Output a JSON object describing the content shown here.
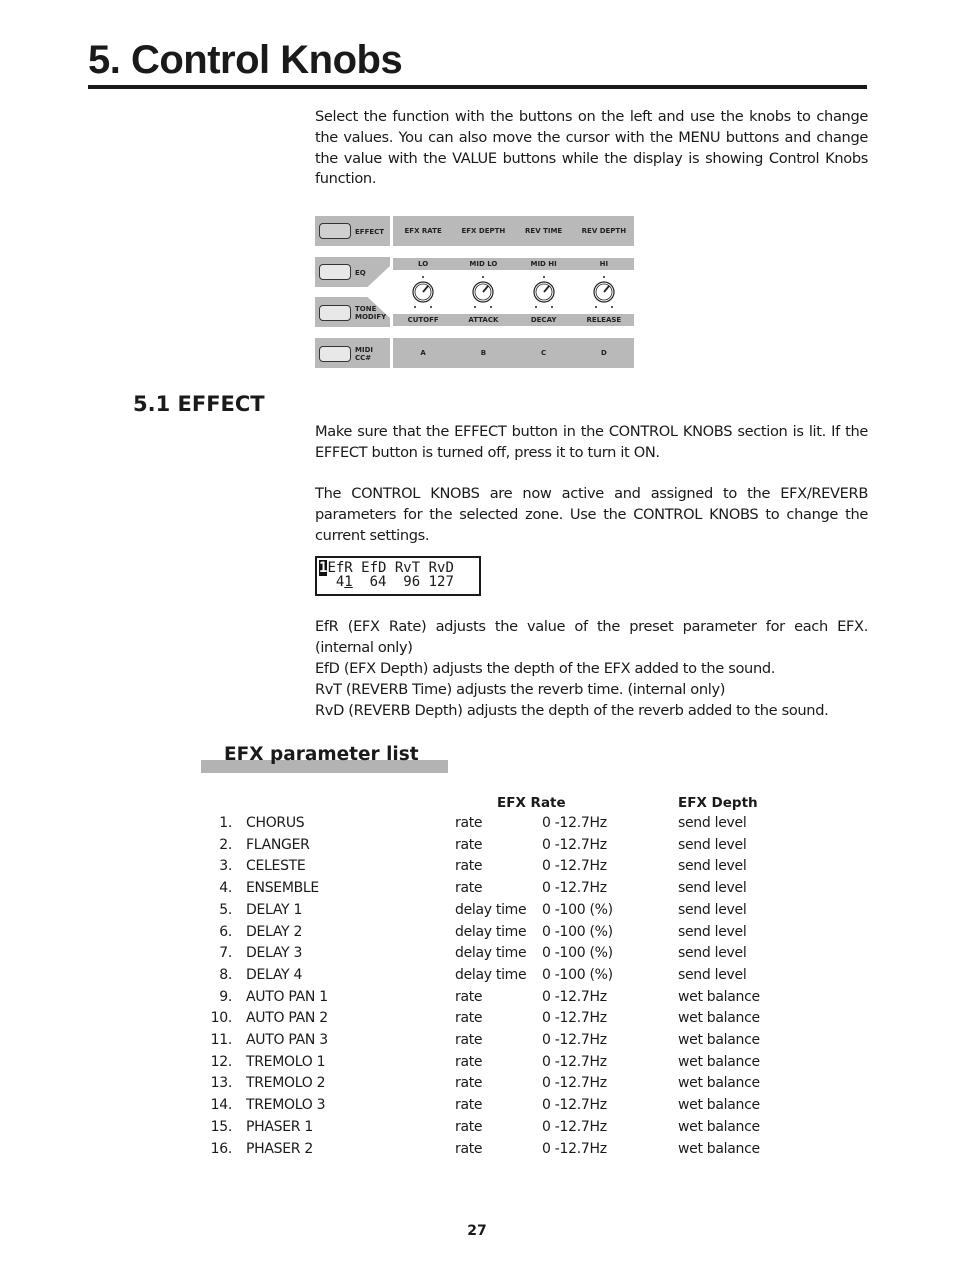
{
  "page": {
    "title": "5. Control Knobs",
    "intro": "Select the function with the buttons on the left and use the knobs to change the values.  You can also move the cursor with the MENU buttons and change the value with the VALUE buttons while the display is showing Control Knobs function.",
    "page_number": "27"
  },
  "panel": {
    "buttons": [
      {
        "label_line1": "EFFECT",
        "label_line2": ""
      },
      {
        "label_line1": "EQ",
        "label_line2": ""
      },
      {
        "label_line1": "TONE",
        "label_line2": "MODIFY"
      },
      {
        "label_line1": "MIDI",
        "label_line2": "CC#"
      }
    ],
    "effect_row": [
      "EFX RATE",
      "EFX DEPTH",
      "REV TIME",
      "REV DEPTH"
    ],
    "eq_row": [
      "LO",
      "MID LO",
      "MID HI",
      "HI"
    ],
    "tone_row": [
      "CUTOFF",
      "ATTACK",
      "DECAY",
      "RELEASE"
    ],
    "midi_row": [
      "A",
      "B",
      "C",
      "D"
    ]
  },
  "section": {
    "heading": "5.1 EFFECT",
    "para1": "Make sure that the EFFECT button in the CONTROL KNOBS section is lit.  If the EFFECT button is turned off, press it to turn it ON.",
    "para2": "The CONTROL KNOBS are now active and assigned to the EFX/REVERB parameters for the selected zone.  Use the CONTROL KNOBS to change the current settings.",
    "lcd": {
      "zone": "1",
      "labels": "EfR EfD RvT RvD",
      "values_prefix": "  4",
      "cursor_digit": "1",
      "values_rest": "  64  96 127"
    },
    "desc": [
      "EfR (EFX Rate) adjusts the value of the preset parameter for each EFX.  (internal only)",
      "EfD (EFX Depth) adjusts the depth of the EFX added to the sound.",
      "RvT (REVERB Time) adjusts the reverb time.  (internal only)",
      "RvD (REVERB Depth) adjusts the depth of the reverb added to the sound."
    ]
  },
  "efx_list": {
    "heading": "EFX parameter list",
    "col_rate": "EFX Rate",
    "col_depth": "EFX Depth",
    "rows": [
      {
        "num": "1.",
        "name": "CHORUS",
        "param": "rate",
        "range": "0 -12.7Hz",
        "depth": "send level"
      },
      {
        "num": "2.",
        "name": "FLANGER",
        "param": "rate",
        "range": "0 -12.7Hz",
        "depth": "send level"
      },
      {
        "num": "3.",
        "name": "CELESTE",
        "param": "rate",
        "range": "0 -12.7Hz",
        "depth": "send level"
      },
      {
        "num": "4.",
        "name": "ENSEMBLE",
        "param": "rate",
        "range": "0 -12.7Hz",
        "depth": "send level"
      },
      {
        "num": "5.",
        "name": "DELAY 1",
        "param": "delay time",
        "range": "0 -100 (%)",
        "depth": "send level"
      },
      {
        "num": "6.",
        "name": "DELAY 2",
        "param": "delay time",
        "range": "0 -100 (%)",
        "depth": "send level"
      },
      {
        "num": "7.",
        "name": "DELAY 3",
        "param": "delay time",
        "range": "0 -100 (%)",
        "depth": "send level"
      },
      {
        "num": "8.",
        "name": "DELAY 4",
        "param": "delay time",
        "range": "0 -100 (%)",
        "depth": "send level"
      },
      {
        "num": "9.",
        "name": "AUTO PAN 1",
        "param": "rate",
        "range": "0 -12.7Hz",
        "depth": "wet balance"
      },
      {
        "num": "10.",
        "name": "AUTO PAN 2",
        "param": "rate",
        "range": "0 -12.7Hz",
        "depth": "wet balance"
      },
      {
        "num": "11.",
        "name": "AUTO PAN 3",
        "param": "rate",
        "range": "0 -12.7Hz",
        "depth": "wet balance"
      },
      {
        "num": "12.",
        "name": "TREMOLO 1",
        "param": "rate",
        "range": "0 -12.7Hz",
        "depth": "wet balance"
      },
      {
        "num": "13.",
        "name": "TREMOLO 2",
        "param": "rate",
        "range": "0 -12.7Hz",
        "depth": "wet balance"
      },
      {
        "num": "14.",
        "name": "TREMOLO 3",
        "param": "rate",
        "range": "0 -12.7Hz",
        "depth": "wet balance"
      },
      {
        "num": "15.",
        "name": "PHASER 1",
        "param": "rate",
        "range": "0 -12.7Hz",
        "depth": "wet balance"
      },
      {
        "num": "16.",
        "name": "PHASER 2",
        "param": "rate",
        "range": "0 -12.7Hz",
        "depth": "wet balance"
      }
    ]
  }
}
